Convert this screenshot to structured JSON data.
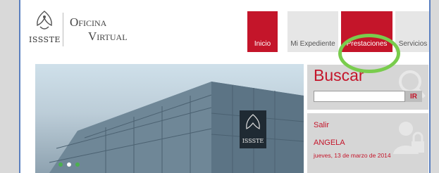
{
  "header": {
    "logo_text": "ISSSTE",
    "title_line1": "Oficina",
    "title_line2": "Virtual"
  },
  "nav": {
    "items": [
      {
        "label": "Inicio",
        "color": "#c4152a"
      },
      {
        "label": "Mi Expediente",
        "color": "#e6e6e6"
      },
      {
        "label": "Prestaciones",
        "color": "#c4152a"
      },
      {
        "label": "Servicios",
        "color": "#e6e6e6"
      }
    ]
  },
  "hero": {
    "sign_text": "ISSSTE"
  },
  "search": {
    "title": "Buscar",
    "input_value": "",
    "button_label": "IR"
  },
  "user": {
    "logout_label": "Salir",
    "username": "ANGELA",
    "date": "jueves, 13 de marzo de 2014"
  },
  "colors": {
    "accent": "#c4152a",
    "highlight": "#79cc4d"
  }
}
